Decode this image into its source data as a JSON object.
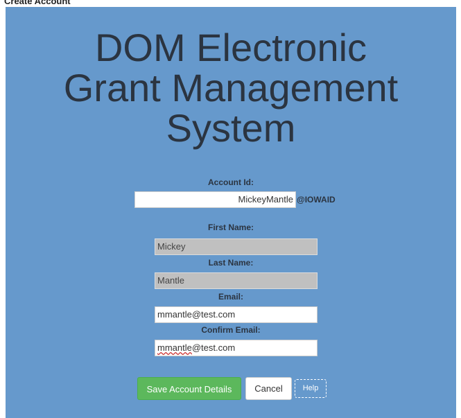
{
  "page": {
    "heading": "Create Account"
  },
  "title": {
    "line1": "DOM Electronic",
    "line2": "Grant Management",
    "line3": "System"
  },
  "form": {
    "account_id": {
      "label": "Account Id:",
      "value": "MickeyMantle",
      "suffix": "@IOWAID"
    },
    "first_name": {
      "label": "First Name:",
      "value": "Mickey"
    },
    "last_name": {
      "label": "Last Name:",
      "value": "Mantle"
    },
    "email": {
      "label": "Email:",
      "value": "mmantle@test.com"
    },
    "confirm_email": {
      "label": "Confirm Email:",
      "value_misspelled_part": "mmantle",
      "value_rest": "@test.com"
    }
  },
  "buttons": {
    "save": "Save Account Details",
    "cancel": "Cancel",
    "help": "Help"
  },
  "colors": {
    "panel_background": "#6699cc",
    "title_text": "#2b3440",
    "save_button": "#5cb85c",
    "readonly_field": "#c0c0c0"
  }
}
